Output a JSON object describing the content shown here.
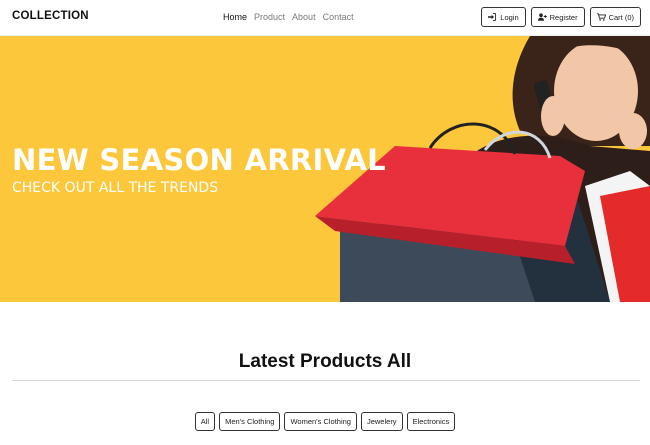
{
  "navbar": {
    "brand": "COLLECTION",
    "links": [
      {
        "label": "Home",
        "active": true
      },
      {
        "label": "Product",
        "active": false
      },
      {
        "label": "About",
        "active": false
      },
      {
        "label": "Contact",
        "active": false
      }
    ],
    "buttons": {
      "login": {
        "label": "Login",
        "icon": "sign-in-icon"
      },
      "register": {
        "label": "Register",
        "icon": "user-plus-icon"
      },
      "cart": {
        "label": "Cart (0)",
        "icon": "cart-icon"
      }
    }
  },
  "hero": {
    "title": "NEW SEASON ARRIVAL",
    "subtitle": "CHECK OUT ALL THE TRENDS",
    "background_color": "#fcc73b"
  },
  "products": {
    "heading": "Latest Products All",
    "filters": [
      "All",
      "Men's Clothing",
      "Women's Clothing",
      "Jewelery",
      "Electronics"
    ]
  }
}
